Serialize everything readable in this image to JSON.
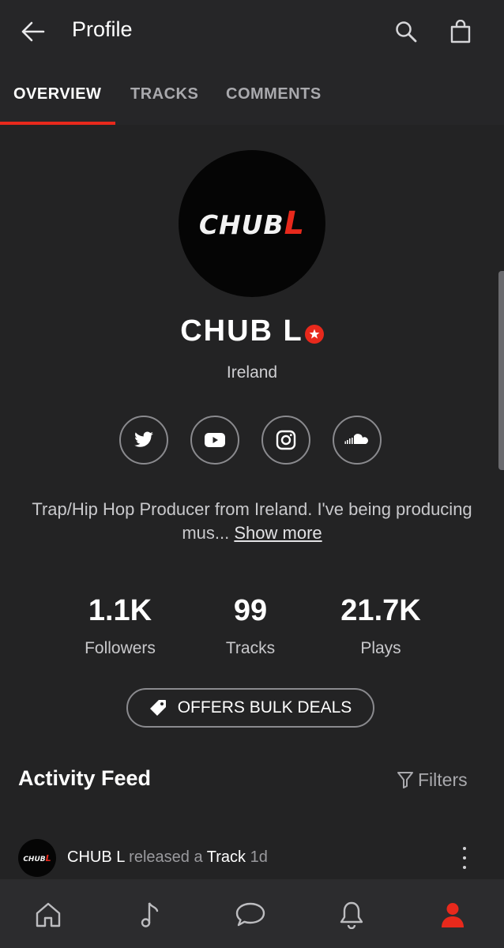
{
  "header": {
    "title": "Profile"
  },
  "tabs": [
    {
      "label": "OVERVIEW",
      "active": true
    },
    {
      "label": "TRACKS",
      "active": false
    },
    {
      "label": "COMMENTS",
      "active": false
    }
  ],
  "profile": {
    "logo_text": "CHUB",
    "logo_l": "L",
    "name": "CHUB L",
    "location": "Ireland",
    "verified_icon": "star-badge-icon",
    "social": [
      "twitter-icon",
      "youtube-icon",
      "instagram-icon",
      "soundcloud-icon"
    ],
    "bio": "Trap/Hip Hop Producer from Ireland. I've being producing mus...",
    "show_more": "Show more"
  },
  "stats": [
    {
      "value": "1.1K",
      "label": "Followers"
    },
    {
      "value": "99",
      "label": "Tracks"
    },
    {
      "value": "21.7K",
      "label": "Plays"
    }
  ],
  "bulk_deals": {
    "label": "OFFERS BULK DEALS"
  },
  "feed": {
    "title": "Activity Feed",
    "filters_label": "Filters",
    "items": [
      {
        "user": "CHUB L",
        "verb": "released a",
        "object": "Track",
        "time": "1d",
        "avatar_text": "CHUB",
        "avatar_l": "L"
      }
    ]
  },
  "bottom_nav": [
    "home-icon",
    "music-note-icon",
    "chat-icon",
    "bell-icon",
    "profile-icon"
  ],
  "colors": {
    "accent": "#e8291c",
    "background": "#232324",
    "bar": "#262628"
  }
}
